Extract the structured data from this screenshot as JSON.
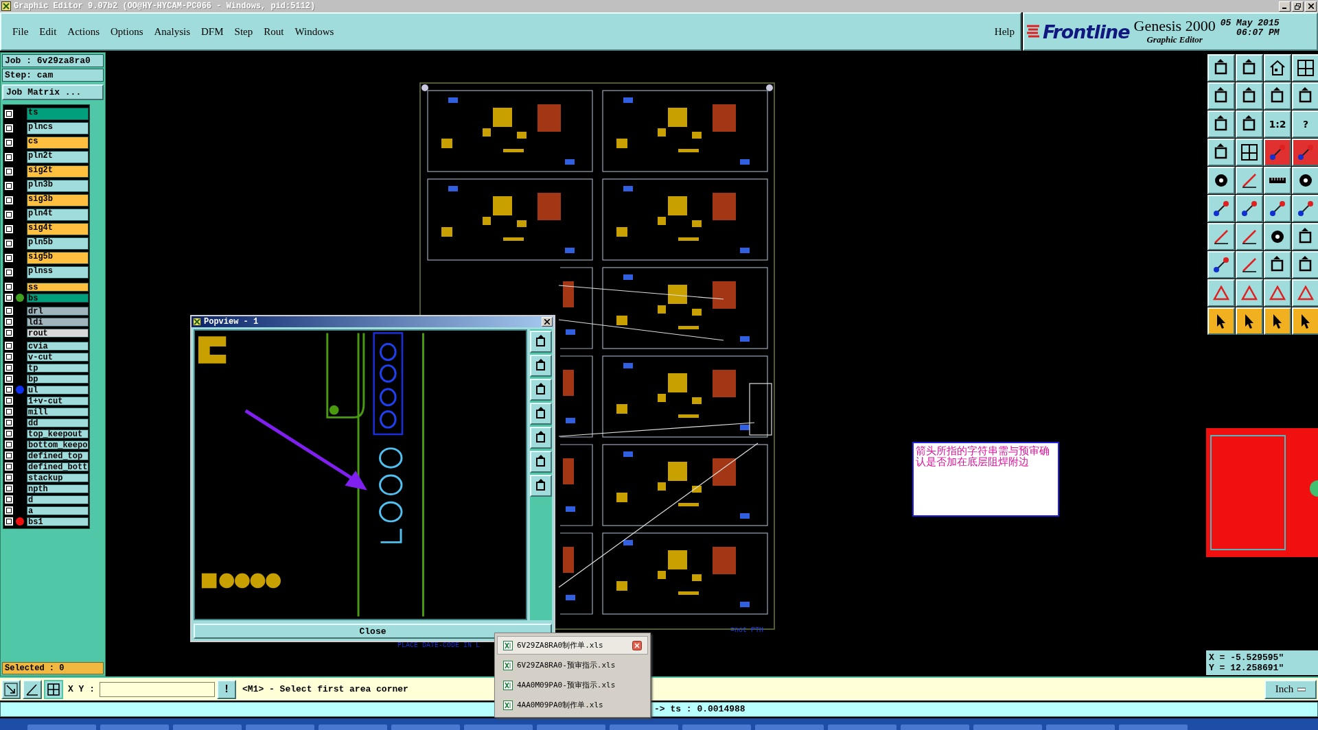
{
  "window": {
    "title": "Graphic Editor 9.07b2 (OO@HY-HYCAM-PC066 - Windows, pid:5112)"
  },
  "menu": [
    "File",
    "Edit",
    "Actions",
    "Options",
    "Analysis",
    "DFM",
    "Step",
    "Rout",
    "Windows"
  ],
  "help": "Help",
  "brand": {
    "logo": "Frontline",
    "product": "Genesis 2000",
    "subtitle": "Graphic Editor",
    "date": "05 May 2015",
    "time": "06:07 PM"
  },
  "job": "Job : 6v29za8ra0",
  "step": "Step: cam",
  "job_matrix_button": "Job Matrix ...",
  "layer_groups": [
    {
      "layers": [
        {
          "name": "ts",
          "kind": "mask"
        },
        {
          "name": "plncs",
          "kind": "plane"
        },
        {
          "name": "cs",
          "kind": "signal"
        },
        {
          "name": "pln2t",
          "kind": "plane"
        },
        {
          "name": "sig2t",
          "kind": "signal"
        },
        {
          "name": "pln3b",
          "kind": "plane"
        },
        {
          "name": "sig3b",
          "kind": "signal"
        },
        {
          "name": "pln4t",
          "kind": "plane"
        },
        {
          "name": "sig4t",
          "kind": "signal"
        },
        {
          "name": "pln5b",
          "kind": "plane"
        },
        {
          "name": "sig5b",
          "kind": "signal"
        },
        {
          "name": "plnss",
          "kind": "plane"
        }
      ]
    },
    {
      "layers": [
        {
          "name": "ss",
          "kind": "signal"
        },
        {
          "name": "bs",
          "kind": "mask",
          "color": "#40a020"
        }
      ]
    },
    {
      "layers": [
        {
          "name": "drl",
          "kind": "drill"
        },
        {
          "name": "ldi",
          "kind": "drill"
        },
        {
          "name": "rout",
          "kind": "rout"
        }
      ]
    },
    {
      "layers": [
        {
          "name": "cvia",
          "kind": "plane"
        },
        {
          "name": "v-cut",
          "kind": "plane"
        },
        {
          "name": "tp",
          "kind": "plane"
        },
        {
          "name": "bp",
          "kind": "plane"
        },
        {
          "name": "ul",
          "kind": "plane",
          "color": "#1030f0"
        },
        {
          "name": "1+v-cut",
          "kind": "plane"
        },
        {
          "name": "mill",
          "kind": "plane"
        },
        {
          "name": "dd",
          "kind": "plane"
        },
        {
          "name": "top_keepout",
          "kind": "plane"
        },
        {
          "name": "bottom_keepo",
          "kind": "plane"
        },
        {
          "name": "defined_top",
          "kind": "plane"
        },
        {
          "name": "defined_bott",
          "kind": "plane"
        },
        {
          "name": "stackup",
          "kind": "plane"
        },
        {
          "name": "npth",
          "kind": "plane"
        },
        {
          "name": "d",
          "kind": "plane"
        },
        {
          "name": "a",
          "kind": "plane"
        },
        {
          "name": "bs1",
          "kind": "plane",
          "color": "#f01010"
        }
      ]
    }
  ],
  "selected_count": "Selected : 0",
  "canvas_notes": [
    {
      "text": "=not PTH"
    },
    {
      "text": "PLACE DATE-CODE IN L"
    }
  ],
  "popview": {
    "title": "Popview - 1",
    "close_button": "Close"
  },
  "annotation": "箭头所指的字符串需与预审确认是否加在底层阻焊附边",
  "toolbar": [
    {
      "kind": "frame"
    },
    {
      "kind": "frame"
    },
    {
      "kind": "house"
    },
    {
      "kind": "grid"
    },
    {
      "kind": "frame"
    },
    {
      "kind": "frame"
    },
    {
      "kind": "frame"
    },
    {
      "kind": "frame"
    },
    {
      "kind": "frame"
    },
    {
      "kind": "frame"
    },
    {
      "kind": "label",
      "label": "1:2"
    },
    {
      "kind": "label",
      "label": "?"
    },
    {
      "kind": "frame"
    },
    {
      "kind": "grid"
    },
    {
      "kind": "nodes",
      "color": "#e03030"
    },
    {
      "kind": "nodes",
      "color": "#e03030"
    },
    {
      "kind": "circle"
    },
    {
      "kind": "line"
    },
    {
      "kind": "ruler"
    },
    {
      "kind": "circle"
    },
    {
      "kind": "nodes"
    },
    {
      "kind": "nodes"
    },
    {
      "kind": "nodes"
    },
    {
      "kind": "nodes"
    },
    {
      "kind": "line"
    },
    {
      "kind": "line"
    },
    {
      "kind": "circle"
    },
    {
      "kind": "frame"
    },
    {
      "kind": "nodes"
    },
    {
      "kind": "line"
    },
    {
      "kind": "frame"
    },
    {
      "kind": "frame"
    },
    {
      "kind": "triangle"
    },
    {
      "kind": "triangle"
    },
    {
      "kind": "triangle"
    },
    {
      "kind": "triangle"
    },
    {
      "kind": "pointer",
      "color": "#f0b020"
    },
    {
      "kind": "pointer",
      "color": "#f0b020"
    },
    {
      "kind": "pointer",
      "color": "#f0b020"
    },
    {
      "kind": "pointer",
      "color": "#f0b020"
    }
  ],
  "coords": {
    "x": "X = -5.529595\"",
    "y": "Y = 12.258691\""
  },
  "xy_label": "X Y :",
  "prompt_button": "!",
  "message": "<M1> - Select first area corner",
  "units": "Inch",
  "status": "-> ts : 0.0014988",
  "recent_files": [
    {
      "name": "6V29ZA8RA0制作单.xls",
      "selected": true
    },
    {
      "name": "6V29ZA8RA0-预审指示.xls",
      "selected": false
    },
    {
      "name": "4AA0M09PA0-预审指示.xls",
      "selected": false
    },
    {
      "name": "4AA0M09PA0制作单.xls",
      "selected": false
    }
  ]
}
